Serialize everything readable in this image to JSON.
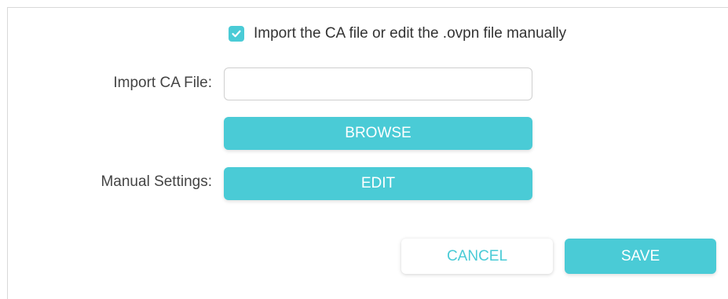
{
  "form": {
    "manual_toggle": {
      "checked": true,
      "label": "Import the CA file or edit the .ovpn file manually"
    },
    "import_ca_file": {
      "label": "Import CA File:",
      "value": "",
      "placeholder": ""
    },
    "browse_label": "BROWSE",
    "manual_settings": {
      "label": "Manual Settings:",
      "edit_label": "EDIT"
    }
  },
  "actions": {
    "cancel_label": "CANCEL",
    "save_label": "SAVE"
  },
  "colors": {
    "accent": "#4acbd6",
    "border": "#d9d9d9"
  },
  "icons": {
    "checkbox": "check-icon"
  }
}
